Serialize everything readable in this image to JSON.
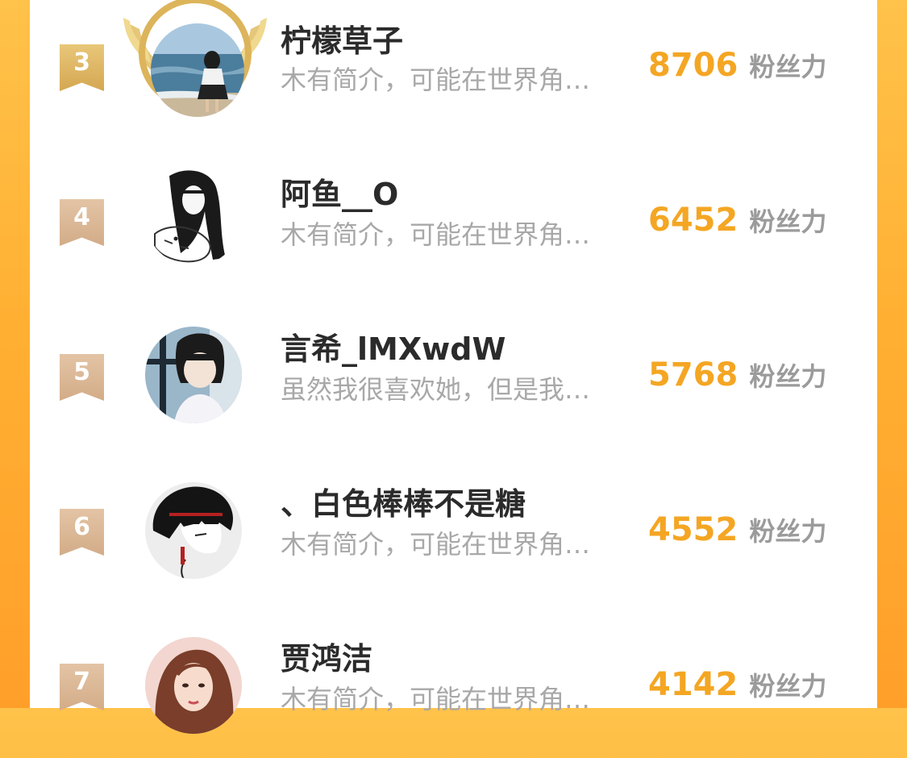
{
  "ranking": {
    "unit_label": "粉丝力",
    "entries": [
      {
        "rank": "3",
        "name": "柠檬草子",
        "bio": "木有简介，可能在世界角…",
        "score": "8706",
        "avatar": "beach-girl-avatar",
        "badge": "gold-laurel-crown"
      },
      {
        "rank": "4",
        "name": "阿鱼__O",
        "bio": "木有简介，可能在世界角…",
        "score": "6452",
        "avatar": "girl-with-wolf-sketch-avatar"
      },
      {
        "rank": "5",
        "name": "言希_lMXwdW",
        "bio": "虽然我很喜欢她，但是我…",
        "score": "5768",
        "avatar": "anime-girl-avatar"
      },
      {
        "rank": "6",
        "name": "、白色棒棒不是糖",
        "bio": "木有简介，可能在世界角…",
        "score": "4552",
        "avatar": "anime-boy-avatar"
      },
      {
        "rank": "7",
        "name": "贾鸿洁",
        "bio": "木有简介，可能在世界角…",
        "score": "4142",
        "avatar": "woman-portrait-avatar"
      }
    ]
  },
  "colors": {
    "score": "#f4a623",
    "gold_ribbon": "#d9ad5c",
    "tan_ribbon": "#d8b594",
    "background_gradient": "#ffb033"
  }
}
